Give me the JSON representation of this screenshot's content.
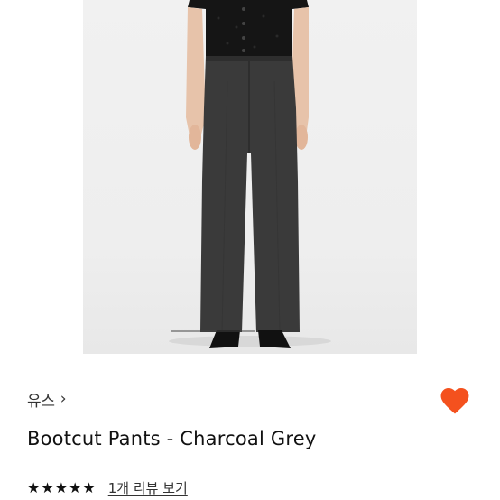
{
  "product": {
    "brand": "유스",
    "brand_chevron": "›",
    "title": "Bootcut Pants - Charcoal Grey",
    "rating": {
      "stars": 5,
      "star_glyph": "★"
    },
    "review_link": "1개 리뷰 보기",
    "liked": true
  },
  "icons": {
    "heart": "heart-icon",
    "chevron": "chevron-right-icon",
    "star": "star-icon"
  },
  "colors": {
    "heart": "#f4511e",
    "text": "#111111",
    "pants": "#3a3a3a",
    "photo_bg": "#efefef"
  }
}
